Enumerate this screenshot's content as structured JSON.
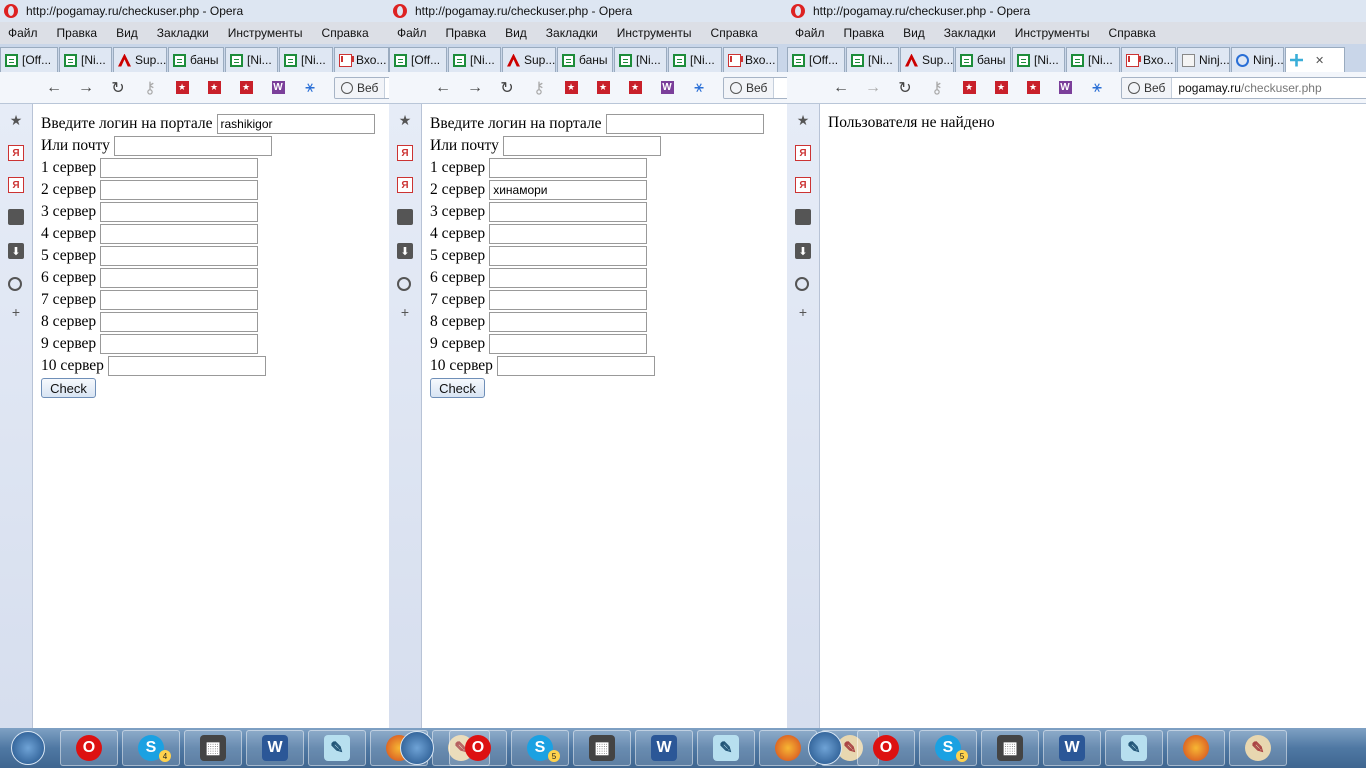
{
  "windows": [
    {
      "title": "http://pogamay.ru/checkuser.php - Opera",
      "menu": [
        "Файл",
        "Правка",
        "Вид",
        "Закладки",
        "Инструменты",
        "Справка"
      ],
      "tabs": [
        {
          "label": "[Off...",
          "icon": "sheet-icon"
        },
        {
          "label": "[Ni...",
          "icon": "sheet-icon"
        },
        {
          "label": "Sup...",
          "icon": "sup-icon"
        },
        {
          "label": "баны",
          "icon": "sheet-icon"
        },
        {
          "label": "[Ni...",
          "icon": "sheet-icon"
        },
        {
          "label": "[Ni...",
          "icon": "sheet-icon"
        },
        {
          "label": "Вхо...",
          "icon": "gmail-icon"
        }
      ],
      "address": {
        "button": "Веб",
        "host": "",
        "path": ""
      },
      "form": {
        "login_label": "Введите логин на портале",
        "login_value": "rashikigor",
        "email_label": "Или почту",
        "email_value": "",
        "servers": [
          {
            "label": "1 сервер",
            "value": ""
          },
          {
            "label": "2 сервер",
            "value": ""
          },
          {
            "label": "3 сервер",
            "value": ""
          },
          {
            "label": "4 сервер",
            "value": ""
          },
          {
            "label": "5 сервер",
            "value": ""
          },
          {
            "label": "6 сервер",
            "value": ""
          },
          {
            "label": "7 сервер",
            "value": ""
          },
          {
            "label": "8 сервер",
            "value": ""
          },
          {
            "label": "9 сервер",
            "value": ""
          },
          {
            "label": "10 сервер",
            "value": ""
          }
        ],
        "submit": "Check"
      }
    },
    {
      "title": "http://pogamay.ru/checkuser.php - Opera",
      "menu": [
        "Файл",
        "Правка",
        "Вид",
        "Закладки",
        "Инструменты",
        "Справка"
      ],
      "tabs": [
        {
          "label": "[Off...",
          "icon": "sheet-icon"
        },
        {
          "label": "[Ni...",
          "icon": "sheet-icon"
        },
        {
          "label": "Sup...",
          "icon": "sup-icon"
        },
        {
          "label": "баны",
          "icon": "sheet-icon"
        },
        {
          "label": "[Ni...",
          "icon": "sheet-icon"
        },
        {
          "label": "[Ni...",
          "icon": "sheet-icon"
        },
        {
          "label": "Вхо...",
          "icon": "gmail-icon"
        }
      ],
      "address": {
        "button": "Веб",
        "host": "",
        "path": ""
      },
      "form": {
        "login_label": "Введите логин на портале",
        "login_value": "",
        "email_label": "Или почту",
        "email_value": "",
        "servers": [
          {
            "label": "1 сервер",
            "value": ""
          },
          {
            "label": "2 сервер",
            "value": "хинамори"
          },
          {
            "label": "3 сервер",
            "value": ""
          },
          {
            "label": "4 сервер",
            "value": ""
          },
          {
            "label": "5 сервер",
            "value": ""
          },
          {
            "label": "6 сервер",
            "value": ""
          },
          {
            "label": "7 сервер",
            "value": ""
          },
          {
            "label": "8 сервер",
            "value": ""
          },
          {
            "label": "9 сервер",
            "value": ""
          },
          {
            "label": "10 сервер",
            "value": ""
          }
        ],
        "submit": "Check"
      }
    },
    {
      "title": "http://pogamay.ru/checkuser.php - Opera",
      "menu": [
        "Файл",
        "Правка",
        "Вид",
        "Закладки",
        "Инструменты",
        "Справка"
      ],
      "tabs": [
        {
          "label": "[Off...",
          "icon": "sheet-icon"
        },
        {
          "label": "[Ni...",
          "icon": "sheet-icon"
        },
        {
          "label": "Sup...",
          "icon": "sup-icon"
        },
        {
          "label": "баны",
          "icon": "sheet-icon"
        },
        {
          "label": "[Ni...",
          "icon": "sheet-icon"
        },
        {
          "label": "[Ni...",
          "icon": "sheet-icon"
        },
        {
          "label": "Вхо...",
          "icon": "gmail-icon"
        },
        {
          "label": "Ninj...",
          "icon": "doc-icon"
        },
        {
          "label": "Ninj...",
          "icon": "naruto-icon"
        },
        {
          "label": "",
          "icon": "puzzle-icon",
          "active": true
        }
      ],
      "address": {
        "button": "Веб",
        "host": "pogamay.ru",
        "path": "/checkuser.php"
      },
      "message": "Пользователя не найдено"
    }
  ],
  "taskbar": {
    "skype_badges": [
      "4",
      "5",
      "5"
    ]
  }
}
